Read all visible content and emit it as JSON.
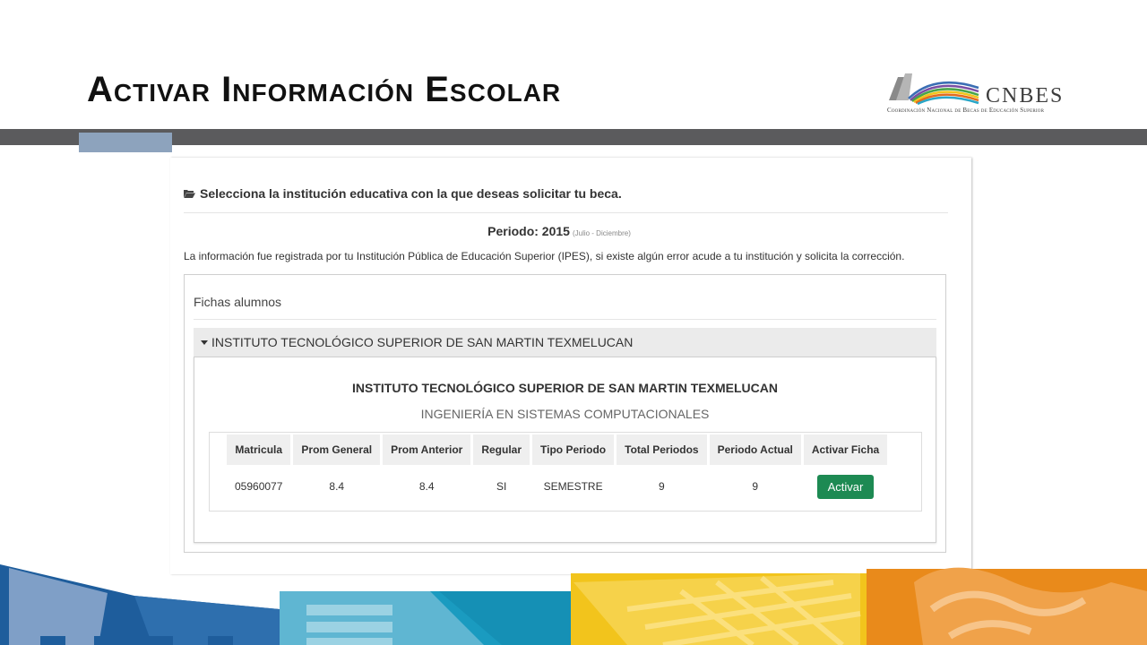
{
  "slide": {
    "title": "Activar Información Escolar"
  },
  "logo": {
    "name": "CNBES",
    "subtitle": "Coordinación Nacional de Becas de Educación Superior"
  },
  "page": {
    "heading": "Selecciona la institución educativa con la que deseas solicitar tu beca.",
    "periodo_label": "Periodo: 2015",
    "periodo_range": "(Julio - Diciembre)",
    "info": "La información fue registrada por tu Institución Pública de Educación Superior (IPES), si existe algún error acude a tu institución y solicita la corrección."
  },
  "fichas": {
    "title": "Fichas alumnos",
    "accordion_label": "INSTITUTO TECNOLÓGICO SUPERIOR DE SAN MARTIN TEXMELUCAN",
    "institution": "INSTITUTO TECNOLÓGICO SUPERIOR DE SAN MARTIN TEXMELUCAN",
    "career": "INGENIERÍA EN SISTEMAS COMPUTACIONALES",
    "table": {
      "headers": [
        "Matricula",
        "Prom General",
        "Prom Anterior",
        "Regular",
        "Tipo Periodo",
        "Total Periodos",
        "Periodo Actual",
        "Activar Ficha"
      ],
      "row": [
        "05960077",
        "8.4",
        "8.4",
        "SI",
        "SEMESTRE",
        "9",
        "9"
      ],
      "button_label": "Activar"
    }
  },
  "colors": {
    "header_bar": "#5b5b5d",
    "header_accent": "#8da3bd",
    "button": "#1d8a53",
    "accordion_bg": "#ebebeb",
    "footer_blue": "#1e5d9c",
    "footer_teal": "#1a9bc0",
    "footer_yellow": "#f2c41c",
    "footer_orange": "#e98a1b"
  }
}
